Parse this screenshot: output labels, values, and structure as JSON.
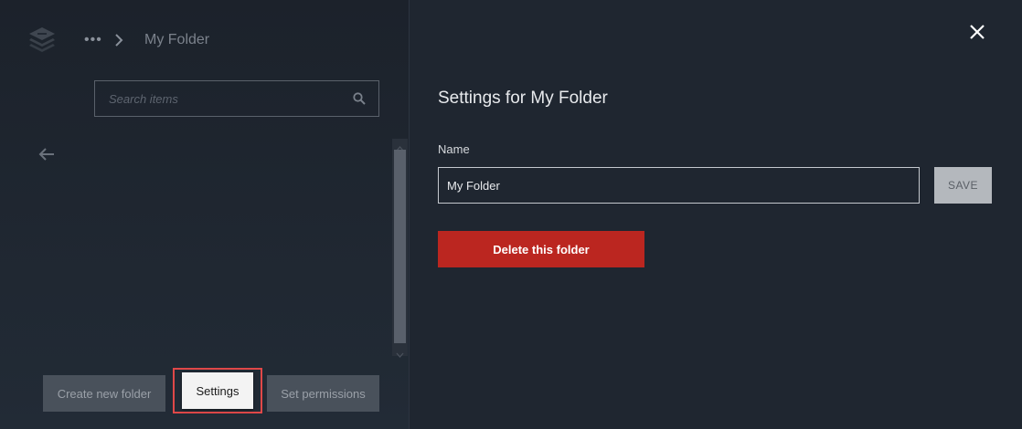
{
  "breadcrumb": {
    "more_label": "•••",
    "current": "My Folder"
  },
  "search": {
    "placeholder": "Search items"
  },
  "left_actions": {
    "create_folder_label": "Create new folder",
    "settings_label": "Settings",
    "set_permissions_label": "Set permissions"
  },
  "settings_panel": {
    "title": "Settings for My Folder",
    "name_label": "Name",
    "name_value": "My Folder",
    "save_label": "SAVE",
    "delete_label": "Delete this folder"
  },
  "icons": {
    "logo": "stack-logo-icon",
    "chevron": "chevron-right-icon",
    "search": "search-icon",
    "back": "arrow-left-icon",
    "close": "close-icon"
  },
  "colors": {
    "background": "#1e2530",
    "delete_button": "#bb2620",
    "highlight": "#e04848",
    "save_button": "#b4b8bd"
  }
}
